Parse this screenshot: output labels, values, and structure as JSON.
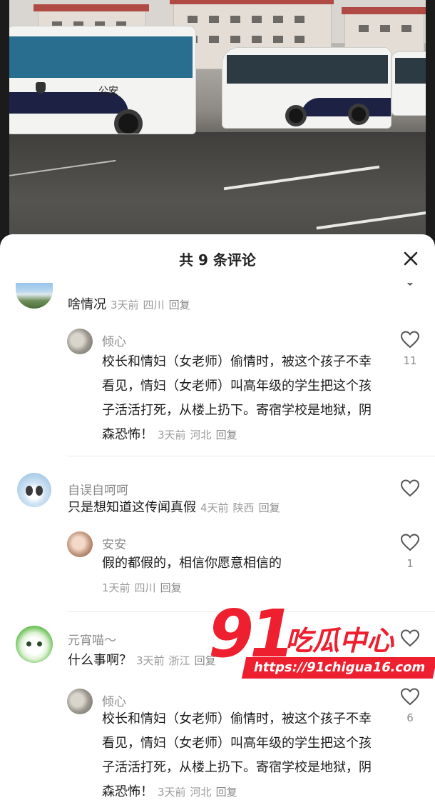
{
  "sheet": {
    "title": "共 9 条评论"
  },
  "video": {
    "bus_text": "公安"
  },
  "comments": [
    {
      "nick": "",
      "text": "啥情况",
      "time": "3天前",
      "location": "四川",
      "reply": "回复"
    },
    {
      "nick": "倾心",
      "text": "校长和情妇（女老师）偷情时，被这个孩子不幸看见，情妇（女老师）叫高年级的学生把这个孩子活活打死，从楼上扔下。寄宿学校是地狱，阴森恐怖！",
      "time": "3天前",
      "location": "河北",
      "reply": "回复",
      "likes": "11"
    },
    {
      "nick": "自误自呵呵",
      "text": "只是想知道这传闻真假",
      "time": "4天前",
      "location": "陕西",
      "reply": "回复"
    },
    {
      "nick": "安安",
      "text": "假的都假的，相信你愿意相信的",
      "time": "1天前",
      "location": "四川",
      "reply": "回复",
      "likes": "1"
    },
    {
      "nick": "元宵喵～",
      "text": "什么事啊？",
      "time": "3天前",
      "location": "浙江",
      "reply": "回复"
    },
    {
      "nick": "倾心",
      "text": "校长和情妇（女老师）偷情时，被这个孩子不幸看见，情妇（女老师）叫高年级的学生把这个孩子活活打死，从楼上扔下。寄宿学校是地狱，阴森恐怖！",
      "time": "3天前",
      "location": "河北",
      "reply": "回复",
      "likes": "6"
    }
  ],
  "watermark": {
    "number": "91",
    "brand": "吃瓜中心",
    "url": "https://91chigua16.com"
  },
  "icons": {
    "close": "close-icon",
    "like": "heart-outline-icon",
    "collapse": "chevron-down-icon"
  }
}
